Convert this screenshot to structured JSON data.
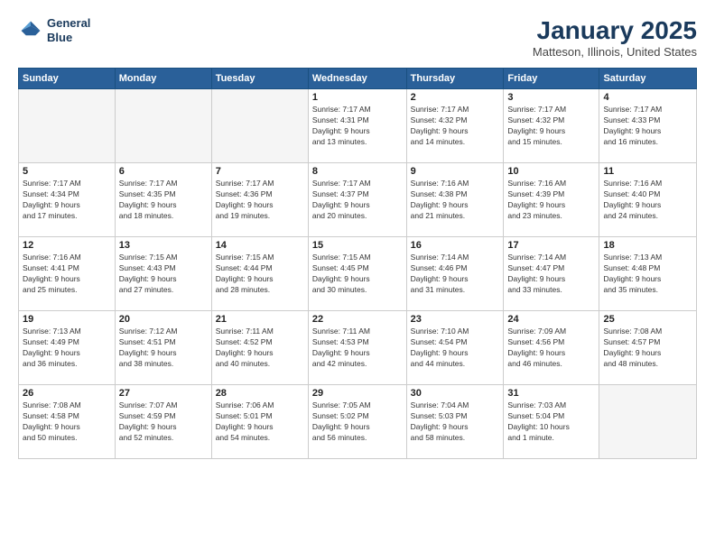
{
  "logo": {
    "line1": "General",
    "line2": "Blue"
  },
  "title": "January 2025",
  "location": "Matteson, Illinois, United States",
  "weekdays": [
    "Sunday",
    "Monday",
    "Tuesday",
    "Wednesday",
    "Thursday",
    "Friday",
    "Saturday"
  ],
  "weeks": [
    [
      {
        "day": "",
        "info": ""
      },
      {
        "day": "",
        "info": ""
      },
      {
        "day": "",
        "info": ""
      },
      {
        "day": "1",
        "info": "Sunrise: 7:17 AM\nSunset: 4:31 PM\nDaylight: 9 hours\nand 13 minutes."
      },
      {
        "day": "2",
        "info": "Sunrise: 7:17 AM\nSunset: 4:32 PM\nDaylight: 9 hours\nand 14 minutes."
      },
      {
        "day": "3",
        "info": "Sunrise: 7:17 AM\nSunset: 4:32 PM\nDaylight: 9 hours\nand 15 minutes."
      },
      {
        "day": "4",
        "info": "Sunrise: 7:17 AM\nSunset: 4:33 PM\nDaylight: 9 hours\nand 16 minutes."
      }
    ],
    [
      {
        "day": "5",
        "info": "Sunrise: 7:17 AM\nSunset: 4:34 PM\nDaylight: 9 hours\nand 17 minutes."
      },
      {
        "day": "6",
        "info": "Sunrise: 7:17 AM\nSunset: 4:35 PM\nDaylight: 9 hours\nand 18 minutes."
      },
      {
        "day": "7",
        "info": "Sunrise: 7:17 AM\nSunset: 4:36 PM\nDaylight: 9 hours\nand 19 minutes."
      },
      {
        "day": "8",
        "info": "Sunrise: 7:17 AM\nSunset: 4:37 PM\nDaylight: 9 hours\nand 20 minutes."
      },
      {
        "day": "9",
        "info": "Sunrise: 7:16 AM\nSunset: 4:38 PM\nDaylight: 9 hours\nand 21 minutes."
      },
      {
        "day": "10",
        "info": "Sunrise: 7:16 AM\nSunset: 4:39 PM\nDaylight: 9 hours\nand 23 minutes."
      },
      {
        "day": "11",
        "info": "Sunrise: 7:16 AM\nSunset: 4:40 PM\nDaylight: 9 hours\nand 24 minutes."
      }
    ],
    [
      {
        "day": "12",
        "info": "Sunrise: 7:16 AM\nSunset: 4:41 PM\nDaylight: 9 hours\nand 25 minutes."
      },
      {
        "day": "13",
        "info": "Sunrise: 7:15 AM\nSunset: 4:43 PM\nDaylight: 9 hours\nand 27 minutes."
      },
      {
        "day": "14",
        "info": "Sunrise: 7:15 AM\nSunset: 4:44 PM\nDaylight: 9 hours\nand 28 minutes."
      },
      {
        "day": "15",
        "info": "Sunrise: 7:15 AM\nSunset: 4:45 PM\nDaylight: 9 hours\nand 30 minutes."
      },
      {
        "day": "16",
        "info": "Sunrise: 7:14 AM\nSunset: 4:46 PM\nDaylight: 9 hours\nand 31 minutes."
      },
      {
        "day": "17",
        "info": "Sunrise: 7:14 AM\nSunset: 4:47 PM\nDaylight: 9 hours\nand 33 minutes."
      },
      {
        "day": "18",
        "info": "Sunrise: 7:13 AM\nSunset: 4:48 PM\nDaylight: 9 hours\nand 35 minutes."
      }
    ],
    [
      {
        "day": "19",
        "info": "Sunrise: 7:13 AM\nSunset: 4:49 PM\nDaylight: 9 hours\nand 36 minutes."
      },
      {
        "day": "20",
        "info": "Sunrise: 7:12 AM\nSunset: 4:51 PM\nDaylight: 9 hours\nand 38 minutes."
      },
      {
        "day": "21",
        "info": "Sunrise: 7:11 AM\nSunset: 4:52 PM\nDaylight: 9 hours\nand 40 minutes."
      },
      {
        "day": "22",
        "info": "Sunrise: 7:11 AM\nSunset: 4:53 PM\nDaylight: 9 hours\nand 42 minutes."
      },
      {
        "day": "23",
        "info": "Sunrise: 7:10 AM\nSunset: 4:54 PM\nDaylight: 9 hours\nand 44 minutes."
      },
      {
        "day": "24",
        "info": "Sunrise: 7:09 AM\nSunset: 4:56 PM\nDaylight: 9 hours\nand 46 minutes."
      },
      {
        "day": "25",
        "info": "Sunrise: 7:08 AM\nSunset: 4:57 PM\nDaylight: 9 hours\nand 48 minutes."
      }
    ],
    [
      {
        "day": "26",
        "info": "Sunrise: 7:08 AM\nSunset: 4:58 PM\nDaylight: 9 hours\nand 50 minutes."
      },
      {
        "day": "27",
        "info": "Sunrise: 7:07 AM\nSunset: 4:59 PM\nDaylight: 9 hours\nand 52 minutes."
      },
      {
        "day": "28",
        "info": "Sunrise: 7:06 AM\nSunset: 5:01 PM\nDaylight: 9 hours\nand 54 minutes."
      },
      {
        "day": "29",
        "info": "Sunrise: 7:05 AM\nSunset: 5:02 PM\nDaylight: 9 hours\nand 56 minutes."
      },
      {
        "day": "30",
        "info": "Sunrise: 7:04 AM\nSunset: 5:03 PM\nDaylight: 9 hours\nand 58 minutes."
      },
      {
        "day": "31",
        "info": "Sunrise: 7:03 AM\nSunset: 5:04 PM\nDaylight: 10 hours\nand 1 minute."
      },
      {
        "day": "",
        "info": ""
      }
    ]
  ]
}
